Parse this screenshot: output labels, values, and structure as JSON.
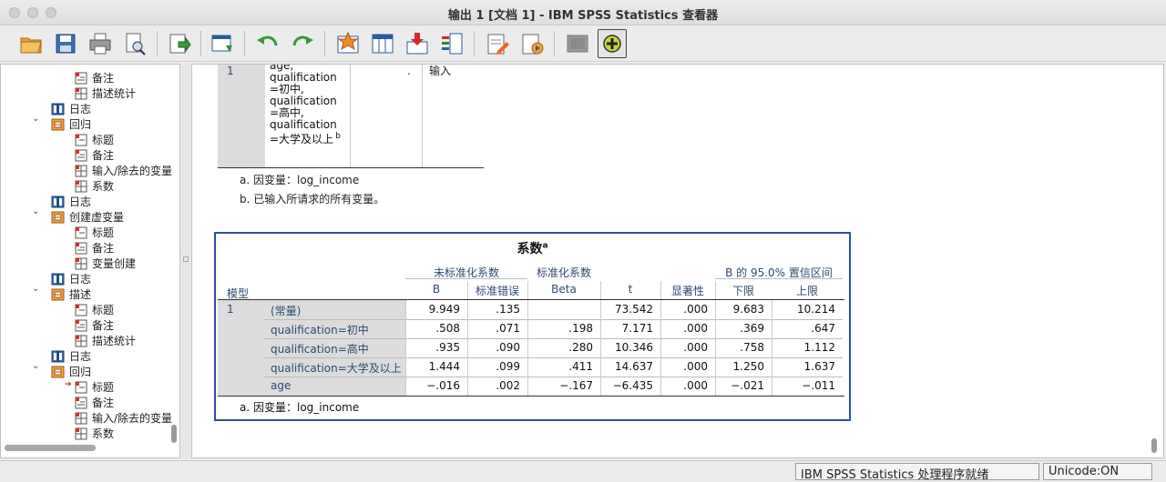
{
  "window": {
    "title": "输出 1 [文档 1] - IBM SPSS Statistics 查看器"
  },
  "toolbar": {
    "buttons": [
      "open-icon",
      "save-icon",
      "print-icon",
      "print-preview-icon",
      "export-icon",
      "goto-data-icon",
      "undo-icon",
      "redo-icon",
      "goto-case-icon",
      "goto-variable-icon",
      "insert-cases-icon",
      "variables-icon",
      "edit-icon",
      "run-script-icon",
      "design-mode-icon",
      "add-icon"
    ]
  },
  "outline": {
    "items": [
      {
        "label": "备注",
        "level": 3,
        "icon": "notes-icon"
      },
      {
        "label": "描述统计",
        "level": 3,
        "icon": "table-icon"
      },
      {
        "label": "日志",
        "level": 2,
        "icon": "log-icon"
      },
      {
        "label": "回归",
        "level": 2,
        "icon": "procedure-icon",
        "expanded": true
      },
      {
        "label": "标题",
        "level": 3,
        "icon": "title-icon"
      },
      {
        "label": "备注",
        "level": 3,
        "icon": "notes-icon"
      },
      {
        "label": "输入/除去的变量",
        "level": 3,
        "icon": "table-icon"
      },
      {
        "label": "系数",
        "level": 3,
        "icon": "table-icon"
      },
      {
        "label": "日志",
        "level": 2,
        "icon": "log-icon"
      },
      {
        "label": "创建虚变量",
        "level": 2,
        "icon": "procedure-icon",
        "expanded": true
      },
      {
        "label": "标题",
        "level": 3,
        "icon": "title-icon"
      },
      {
        "label": "备注",
        "level": 3,
        "icon": "notes-icon"
      },
      {
        "label": "变量创建",
        "level": 3,
        "icon": "table-icon"
      },
      {
        "label": "日志",
        "level": 2,
        "icon": "log-icon"
      },
      {
        "label": "描述",
        "level": 2,
        "icon": "procedure-icon",
        "expanded": true
      },
      {
        "label": "标题",
        "level": 3,
        "icon": "title-icon"
      },
      {
        "label": "备注",
        "level": 3,
        "icon": "notes-icon"
      },
      {
        "label": "描述统计",
        "level": 3,
        "icon": "table-icon"
      },
      {
        "label": "日志",
        "level": 2,
        "icon": "log-icon"
      },
      {
        "label": "回归",
        "level": 2,
        "icon": "procedure-icon",
        "expanded": true
      },
      {
        "label": "标题",
        "level": 3,
        "icon": "title-icon",
        "current": true
      },
      {
        "label": "备注",
        "level": 3,
        "icon": "notes-icon"
      },
      {
        "label": "输入/除去的变量",
        "level": 3,
        "icon": "table-icon"
      },
      {
        "label": "系数",
        "level": 3,
        "icon": "table-icon"
      }
    ]
  },
  "entered_table": {
    "model": "1",
    "variables_lines": [
      "age,",
      "qualification",
      "=初中,",
      "qualification",
      "=高中,",
      "qualification",
      "=大学及以上"
    ],
    "variables_sup": "b",
    "removed": ".",
    "method": "输入",
    "footnote_a": "a. 因变量：log_income",
    "footnote_b": "b. 已输入所请求的所有变量。"
  },
  "coef_table": {
    "title": "系数",
    "title_sup": "a",
    "header": {
      "model": "模型",
      "unstd": "未标准化系数",
      "std": "标准化系数",
      "ci": "B 的 95.0% 置信区间",
      "b": "B",
      "se": "标准错误",
      "beta": "Beta",
      "t": "t",
      "sig": "显著性",
      "lower": "下限",
      "upper": "上限"
    },
    "model_num": "1",
    "rows": [
      {
        "name": "(常量)",
        "b": "9.949",
        "se": ".135",
        "beta": "",
        "t": "73.542",
        "sig": ".000",
        "lower": "9.683",
        "upper": "10.214"
      },
      {
        "name": "qualification=初中",
        "b": ".508",
        "se": ".071",
        "beta": ".198",
        "t": "7.171",
        "sig": ".000",
        "lower": ".369",
        "upper": ".647"
      },
      {
        "name": "qualification=高中",
        "b": ".935",
        "se": ".090",
        "beta": ".280",
        "t": "10.346",
        "sig": ".000",
        "lower": ".758",
        "upper": "1.112"
      },
      {
        "name": "qualification=大学及以上",
        "b": "1.444",
        "se": ".099",
        "beta": ".411",
        "t": "14.637",
        "sig": ".000",
        "lower": "1.250",
        "upper": "1.637"
      },
      {
        "name": "age",
        "b": "−.016",
        "se": ".002",
        "beta": "−.167",
        "t": "−6.435",
        "sig": ".000",
        "lower": "−.021",
        "upper": "−.011"
      }
    ],
    "footnote": "a. 因变量：log_income",
    "selected_border_color": "#2a4fa8"
  },
  "status": {
    "processor": "IBM SPSS Statistics 处理程序就绪",
    "unicode": "Unicode:ON"
  }
}
